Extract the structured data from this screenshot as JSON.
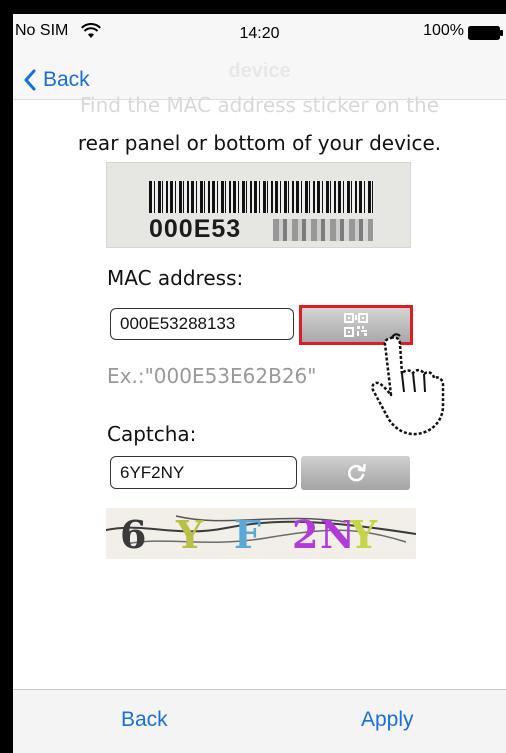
{
  "status_bar": {
    "carrier": "No SIM",
    "time": "14:20",
    "battery": "100%"
  },
  "nav": {
    "title": "device",
    "back_label": "Back",
    "hint": "Find the MAC address sticker on the"
  },
  "instruction": "rear panel or bottom of your device.",
  "sticker": {
    "text": "000E53"
  },
  "mac": {
    "label": "MAC address:",
    "value": "000E53288133",
    "example": "Ex.:\"000E53E62B26\""
  },
  "captcha": {
    "label": "Captcha:",
    "value": "6YF2NY",
    "chars": [
      "6",
      "Y",
      "F",
      "2",
      "N",
      "Y"
    ]
  },
  "toolbar": {
    "back_label": "Back",
    "apply_label": "Apply"
  },
  "colors": {
    "accent": "#1a6fd6",
    "highlight": "#e01b24"
  },
  "icons": {
    "scan": "qr-code-icon",
    "refresh": "refresh-icon",
    "pointer": "hand-pointer-icon"
  }
}
